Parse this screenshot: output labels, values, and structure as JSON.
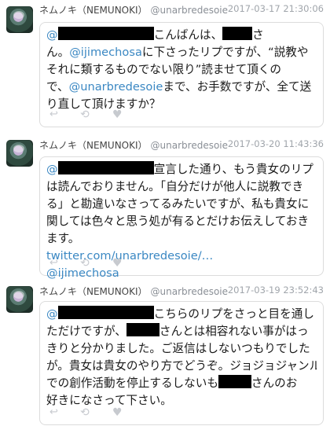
{
  "tweets": [
    {
      "name": "ネムノキ（NEMUNOKI）",
      "handle": "@unarbredesoie",
      "time": "2017-03-17 21:30:06",
      "lines": [
        [
          {
            "t": "m",
            "v": "@"
          },
          {
            "t": "r",
            "w": 122
          },
          {
            "t": "x",
            "v": "こんばんは、"
          },
          {
            "t": "r",
            "w": 38
          },
          {
            "t": "x",
            "v": "さ"
          }
        ],
        [
          {
            "t": "x",
            "v": "ん。"
          },
          {
            "t": "m",
            "v": "@ijimechosa"
          },
          {
            "t": "x",
            "v": "に下さったリプですが、“説教や"
          }
        ],
        [
          {
            "t": "x",
            "v": "それに類するものでない限り”読ませて頂くの"
          }
        ],
        [
          {
            "t": "x",
            "v": "で、"
          },
          {
            "t": "m",
            "v": "@unarbredesoie"
          },
          {
            "t": "x",
            "v": "まで、お手数ですが、全て送"
          }
        ],
        [
          {
            "t": "x",
            "v": "り直して頂けますか？"
          }
        ]
      ]
    },
    {
      "name": "ネムノキ（NEMUNOKI）",
      "handle": "@unarbredesoie",
      "time": "2017-03-20 11:43:36",
      "lines": [
        [
          {
            "t": "m",
            "v": "@"
          },
          {
            "t": "r",
            "w": 122
          },
          {
            "t": "x",
            "v": "宣言した通り、もう貴女のリプ"
          }
        ],
        [
          {
            "t": "x",
            "v": "は読んでおりません。「自分だけが他人に説教でき"
          }
        ],
        [
          {
            "t": "x",
            "v": "る」と勘違いなさってるみたいですが、私も貴女に"
          }
        ],
        [
          {
            "t": "x",
            "v": "関しては色々と思う処が有るとだけお伝えしておき"
          }
        ],
        [
          {
            "t": "x",
            "v": "ます。"
          }
        ],
        [
          {
            "t": "l",
            "v": "twitter.com/unarbredesoie/…"
          }
        ],
        [
          {
            "t": "m",
            "v": "@ijimechosa"
          }
        ]
      ]
    },
    {
      "name": "ネムノキ（NEMUNOKI）",
      "handle": "@unarbredesoie",
      "time": "2017-03-19 23:52:43",
      "lines": [
        [
          {
            "t": "m",
            "v": "@"
          },
          {
            "t": "r",
            "w": 122
          },
          {
            "t": "x",
            "v": "こちらのリプをさっと目を通し"
          }
        ],
        [
          {
            "t": "x",
            "v": "ただけですが、"
          },
          {
            "t": "r",
            "w": 42
          },
          {
            "t": "x",
            "v": "さんとは相容れない事がはっ"
          }
        ],
        [
          {
            "t": "x",
            "v": "きりと分かりました。ご返信はしないつもりでした"
          }
        ],
        [
          {
            "t": "x",
            "v": "が。貴女は貴女のやり方でどうぞ。ジョジョジャンル"
          }
        ],
        [
          {
            "t": "x",
            "v": "での創作活動を停止するしないも"
          },
          {
            "t": "r",
            "w": 42
          },
          {
            "t": "x",
            "v": "さんのお"
          }
        ],
        [
          {
            "t": "x",
            "v": "好きになさって下さい。"
          }
        ]
      ]
    }
  ],
  "actions": {
    "reply_icon": "reply-icon",
    "retweet_icon": "retweet-icon",
    "favorite_icon": "heart-icon"
  }
}
